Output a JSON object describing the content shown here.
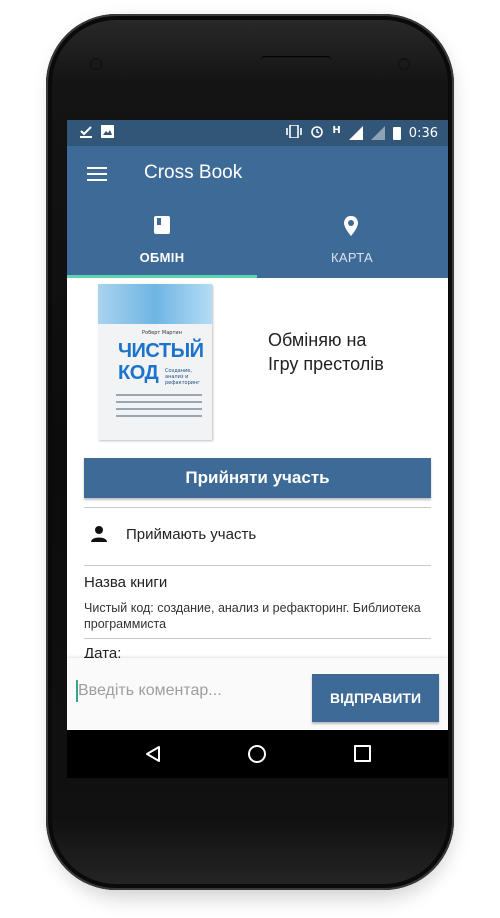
{
  "status_bar": {
    "time": "0:36",
    "network_indicator": "H",
    "left_icons": [
      "download-done-icon",
      "image-icon"
    ],
    "right_icons": [
      "vibrate-icon",
      "alarm-icon",
      "signal-icon",
      "battery-icon"
    ]
  },
  "toolbar": {
    "title": "Cross Book",
    "menu_icon": "hamburger-icon"
  },
  "tabs": [
    {
      "label": "ОБМІН",
      "icon": "book-icon",
      "selected": true
    },
    {
      "label": "КАРТА",
      "icon": "map-pin-icon",
      "selected": false
    }
  ],
  "offer": {
    "line1": "Обміняю на",
    "line2": "Ігру престолів",
    "cover": {
      "author": "Роберт Мартин",
      "title_line1": "ЧИСТЫЙ",
      "title_line2": "КОД",
      "subtitle": "Создание, анализ и рефакторинг"
    }
  },
  "actions": {
    "join_label": "Прийняти участь"
  },
  "participants": {
    "label": "Приймають участь",
    "icon": "person-icon"
  },
  "book": {
    "name_label": "Назва книги",
    "name_value": "Чистый код: создание, анализ и рефакторинг. Библиотека программиста",
    "date_label": "Дата:"
  },
  "comment": {
    "placeholder": "Введіть коментар...",
    "send_label": "ВІДПРАВИТИ"
  },
  "colors": {
    "primary": "#3d6a96",
    "status_bar": "#325678",
    "tab_indicator": "#5fd3b0"
  }
}
